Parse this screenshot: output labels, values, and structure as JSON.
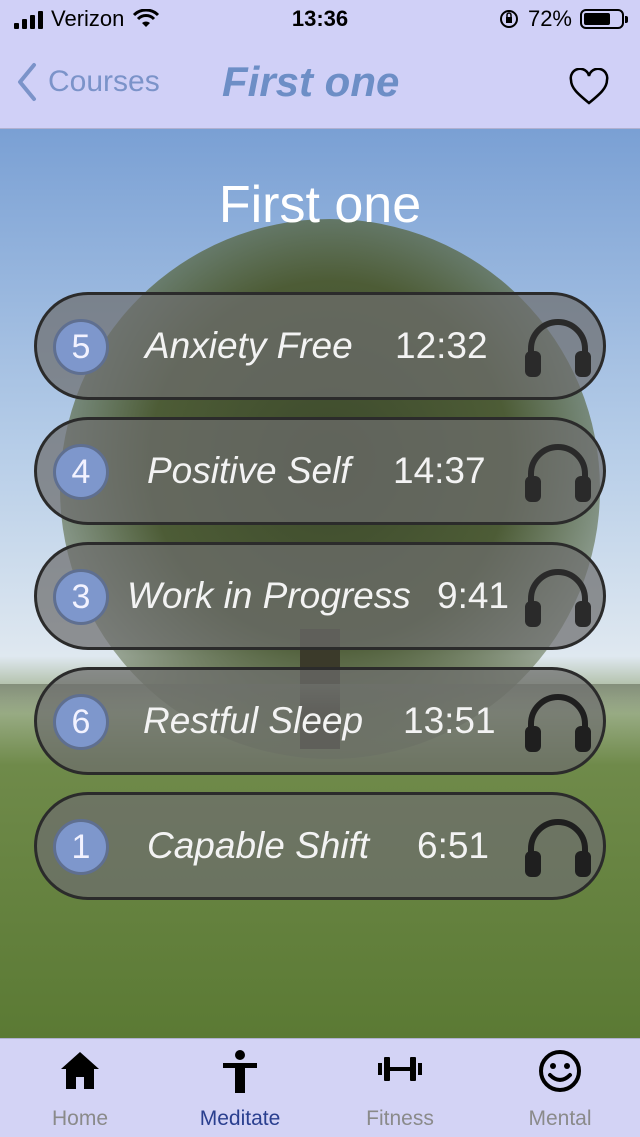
{
  "status_bar": {
    "carrier": "Verizon",
    "time": "13:36",
    "battery": "72%",
    "battery_level": 0.72
  },
  "nav": {
    "back_label": "Courses",
    "title": "First one"
  },
  "content": {
    "title": "First one"
  },
  "tracks": [
    {
      "number": "5",
      "name": "Anxiety Free",
      "duration": "12:32"
    },
    {
      "number": "4",
      "name": "Positive Self",
      "duration": "14:37"
    },
    {
      "number": "3",
      "name": "Work in Progress",
      "duration": "9:41"
    },
    {
      "number": "6",
      "name": "Restful Sleep",
      "duration": "13:51"
    },
    {
      "number": "1",
      "name": "Capable Shift",
      "duration": "6:51"
    }
  ],
  "tabs": [
    {
      "label": "Home",
      "icon": "home-icon"
    },
    {
      "label": "Meditate",
      "icon": "person-icon",
      "active": true
    },
    {
      "label": "Fitness",
      "icon": "dumbbell-icon"
    },
    {
      "label": "Mental",
      "icon": "smiley-icon"
    }
  ],
  "colors": {
    "bar_background": "#d0d0f7",
    "accent": "#6d8ec6",
    "active_tab": "#2a3f8f",
    "badge": "#7e97cc"
  }
}
